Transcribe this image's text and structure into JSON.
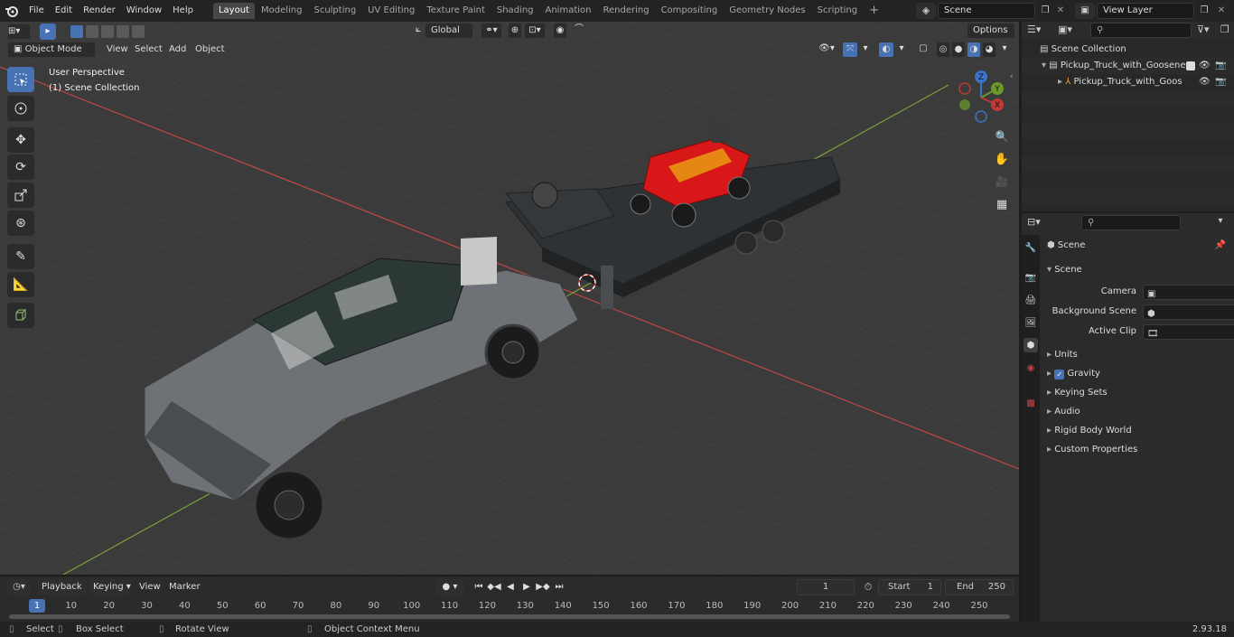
{
  "topbar": {
    "menus": [
      "File",
      "Edit",
      "Render",
      "Window",
      "Help"
    ],
    "workspace_tabs": [
      "Layout",
      "Modeling",
      "Sculpting",
      "UV Editing",
      "Texture Paint",
      "Shading",
      "Animation",
      "Rendering",
      "Compositing",
      "Geometry Nodes",
      "Scripting"
    ],
    "active_tab": "Layout",
    "add_tab": "+",
    "scene_name": "Scene",
    "view_layer": "View Layer"
  },
  "viewport": {
    "mode": "Object Mode",
    "menus": [
      "View",
      "Select",
      "Add",
      "Object"
    ],
    "transform_orientation": "Global",
    "options_label": "Options",
    "overlay_line1": "User Perspective",
    "overlay_line2": "(1) Scene Collection",
    "gizmo": {
      "z": "Z",
      "y": "Y",
      "x": "X"
    }
  },
  "outliner": {
    "root": "Scene Collection",
    "collection": "Pickup_Truck_with_Goosenec",
    "object": "Pickup_Truck_with_Goos"
  },
  "properties": {
    "context": "Scene",
    "panel": "Scene",
    "camera_label": "Camera",
    "background_label": "Background Scene",
    "clip_label": "Active Clip",
    "sections": [
      "Units",
      "Gravity",
      "Keying Sets",
      "Audio",
      "Rigid Body World",
      "Custom Properties"
    ],
    "gravity_checked": true
  },
  "timeline": {
    "menus": [
      "Playback",
      "Keying",
      "View",
      "Marker"
    ],
    "current_frame": "1",
    "start_label": "Start",
    "start_value": "1",
    "end_label": "End",
    "end_value": "250",
    "ticks": [
      "1",
      "10",
      "20",
      "30",
      "40",
      "50",
      "60",
      "70",
      "80",
      "90",
      "100",
      "110",
      "120",
      "130",
      "140",
      "150",
      "160",
      "170",
      "180",
      "190",
      "200",
      "210",
      "220",
      "230",
      "240",
      "250"
    ]
  },
  "statusbar": {
    "select": "Select",
    "box_select": "Box Select",
    "rotate": "Rotate View",
    "context_menu": "Object Context Menu",
    "version": "2.93.18"
  },
  "colors": {
    "accent": "#4772b3",
    "viewport_bg": "#3b3b3b",
    "x_axis": "#d04040",
    "y_axis": "#80b030",
    "truck_body": "#6e7276",
    "mower_red": "#d81818"
  }
}
